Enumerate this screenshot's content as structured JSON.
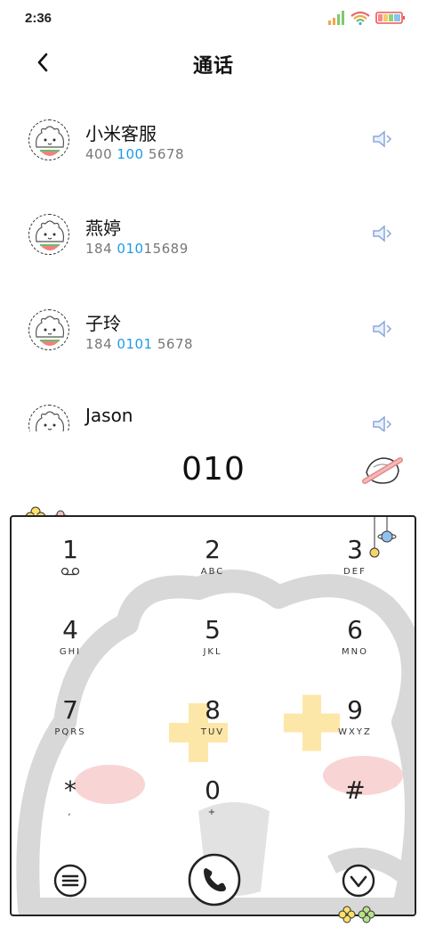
{
  "status_bar": {
    "time": "2:36",
    "icons": [
      "signal-icon",
      "wifi-icon",
      "battery-icon"
    ]
  },
  "header": {
    "title": "通话",
    "back_icon": "chevron-left-icon"
  },
  "contacts": [
    {
      "name": "小米客服",
      "number_parts": [
        "400",
        " 100",
        " 5678"
      ]
    },
    {
      "name": "燕婷",
      "number_parts": [
        "184 ",
        "010",
        "15689"
      ]
    },
    {
      "name": "子玲",
      "number_parts": [
        "184 ",
        "0101",
        " 5678"
      ]
    },
    {
      "name": "Jason",
      "number_parts": [
        "",
        "",
        ""
      ]
    }
  ],
  "dialer": {
    "input": "010",
    "delete_icon": "backspace-icon"
  },
  "keypad": {
    "keys": [
      {
        "digit": "1",
        "letters": "voicemail"
      },
      {
        "digit": "2",
        "letters": "ABC"
      },
      {
        "digit": "3",
        "letters": "DEF"
      },
      {
        "digit": "4",
        "letters": "GHI"
      },
      {
        "digit": "5",
        "letters": "JKL"
      },
      {
        "digit": "6",
        "letters": "MNO"
      },
      {
        "digit": "7",
        "letters": "PQRS"
      },
      {
        "digit": "8",
        "letters": "TUV"
      },
      {
        "digit": "9",
        "letters": "WXYZ"
      },
      {
        "digit": "*",
        "letters": ","
      },
      {
        "digit": "0",
        "letters": "+"
      },
      {
        "digit": "#",
        "letters": ""
      }
    ],
    "bottom": [
      "menu-icon",
      "phone-call-icon",
      "collapse-icon"
    ]
  },
  "colors": {
    "highlight": "#1e9be6",
    "theme_outline": "#222222",
    "decor_pink": "#f7c9c9",
    "decor_yellow": "#fde7a8",
    "decor_grey": "#d8d8d8"
  }
}
